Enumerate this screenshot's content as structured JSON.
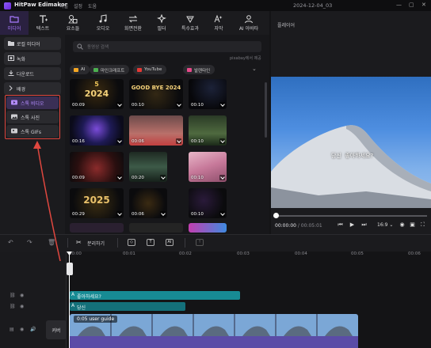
{
  "app": {
    "name": "HitPaw Edimakor",
    "menus": [
      "파일",
      "설정",
      "도움"
    ],
    "project_title": "2024-12-04_03",
    "window_controls": [
      "—",
      "▢",
      "✕"
    ]
  },
  "toolbar": {
    "items": [
      {
        "label": "미디어",
        "icon": "folder-icon",
        "active": true
      },
      {
        "label": "텍스트",
        "icon": "text-icon"
      },
      {
        "label": "요소들",
        "icon": "elements-icon"
      },
      {
        "label": "오디오",
        "icon": "audio-icon"
      },
      {
        "label": "화면전환",
        "icon": "transition-icon"
      },
      {
        "label": "필터",
        "icon": "filter-icon"
      },
      {
        "label": "특수효과",
        "icon": "effects-icon"
      },
      {
        "label": "자막",
        "icon": "subtitle-icon"
      },
      {
        "label": "AI 아바타",
        "icon": "ai-avatar-icon"
      }
    ]
  },
  "sidebar": {
    "categories": [
      {
        "label": "로컬 미디어",
        "icon": "folder-icon"
      },
      {
        "label": "녹화",
        "icon": "record-icon"
      },
      {
        "label": "다운로드",
        "icon": "download-icon"
      },
      {
        "label": "배경",
        "icon": "chevron-right-icon"
      }
    ],
    "stock_items": [
      {
        "label": "스톡 비디오",
        "icon": "video-icon",
        "selected": true
      },
      {
        "label": "스톡 사진",
        "icon": "photo-icon"
      },
      {
        "label": "스톡 GIFs",
        "icon": "gif-icon"
      }
    ]
  },
  "media": {
    "search_placeholder": "동영상 검색",
    "source_label": "pixabay에서 제공",
    "chips": [
      {
        "label": "AI",
        "color": "#f5a623"
      },
      {
        "label": "마인크래프트",
        "color": "#4caf50"
      },
      {
        "label": "YouTube",
        "color": "#e53935"
      },
      {
        "label": "발렌타인",
        "color": "#e84a8a"
      }
    ],
    "thumbnails": [
      {
        "duration": "00:09",
        "text": "2024"
      },
      {
        "duration": "00:10",
        "text": "GOOD BYE 2024"
      },
      {
        "duration": "00:10",
        "text": ""
      },
      {
        "duration": "00:16",
        "text": ""
      },
      {
        "duration": "00:06",
        "text": ""
      },
      {
        "duration": "00:10",
        "text": ""
      },
      {
        "duration": "00:09",
        "text": ""
      },
      {
        "duration": "00:20",
        "text": ""
      },
      {
        "duration": "00:10",
        "text": ""
      },
      {
        "duration": "00:29",
        "text": "2025"
      },
      {
        "duration": "00:06",
        "text": ""
      },
      {
        "duration": "00:10",
        "text": ""
      }
    ]
  },
  "player": {
    "title": "플레이어",
    "subtitle": "당신  좋아하세요?",
    "current_time": "00:00:00",
    "total_time": "/ 00:05:01",
    "aspect_ratio": "16:9",
    "progress": 0.0
  },
  "edit": {
    "split_label": "분리하기"
  },
  "timeline": {
    "ruler": [
      "00:00",
      "00:01",
      "00:02",
      "00:03",
      "00:04",
      "00:05"
    ],
    "text_clips": [
      "좋아하세요?",
      "당신"
    ],
    "video_clip_label": "0:05 user guide",
    "cover_label": "커버"
  },
  "colors": {
    "accent": "#a97bff",
    "highlight_box": "#e0473f",
    "text_clip": "#178b94",
    "video_bar": "#5b4ca7"
  }
}
